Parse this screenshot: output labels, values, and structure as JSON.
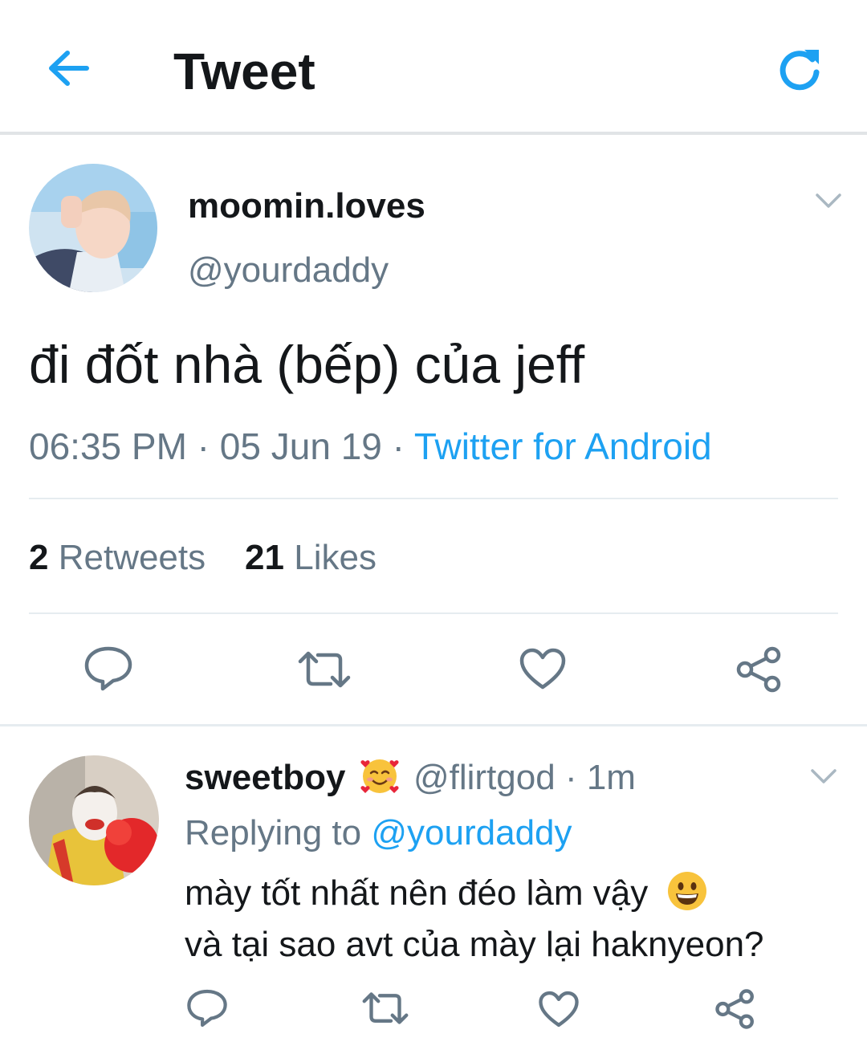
{
  "header": {
    "title": "Tweet",
    "back_icon": "arrow-left-icon",
    "refresh_icon": "refresh-icon",
    "accent": "#1da1f2"
  },
  "tweet": {
    "display_name": "moomin.loves",
    "handle": "@yourdaddy",
    "text": "đi đốt nhà (bếp) của jeff",
    "time": "06:35 PM",
    "sep1": " · ",
    "date": "05 Jun 19",
    "sep2": " · ",
    "source": "Twitter for Android",
    "retweets_count": "2",
    "retweets_label": "Retweets",
    "likes_count": "21",
    "likes_label": "Likes"
  },
  "reply": {
    "display_name": "sweetboy",
    "name_emoji": "smiling-face-with-hearts-icon",
    "handle": "@flirtgod",
    "sep": " · ",
    "time": "1m",
    "replying_prefix": "Replying to",
    "replying_handle": "@yourdaddy",
    "line1": "mày tốt nhất nên đéo làm vậy",
    "line1_emoji": "grinning-face-icon",
    "line2": "và tại sao avt của mày lại haknyeon?"
  },
  "colors": {
    "text": "#14171a",
    "secondary": "#657786",
    "link": "#1da1f2",
    "divider": "#e6ecf0"
  }
}
